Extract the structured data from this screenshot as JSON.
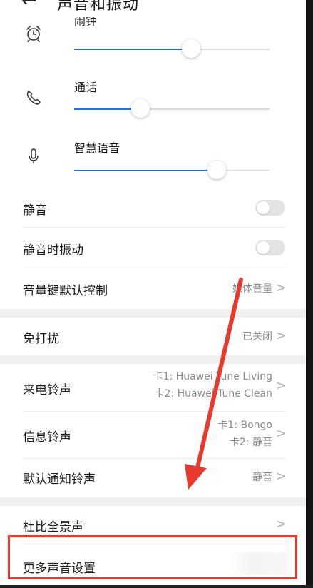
{
  "header": {
    "title": "声音和振动"
  },
  "sliders": [
    {
      "label": "闹钟",
      "icon": "alarm-clock-icon",
      "level": 0.6
    },
    {
      "label": "通话",
      "icon": "phone-icon",
      "level": 0.34
    },
    {
      "label": "智慧语音",
      "icon": "microphone-icon",
      "level": 0.73
    }
  ],
  "toggles": [
    {
      "label": "静音",
      "on": false
    },
    {
      "label": "静音时振动",
      "on": false
    }
  ],
  "volume_key": {
    "label": "音量键默认控制",
    "value": "媒体音量"
  },
  "dnd": {
    "label": "免打扰",
    "value": "已关闭"
  },
  "ringtone": {
    "label": "来电铃声",
    "value_line1": "卡1: Huawei Tune Living",
    "value_line2": "卡2: Huawei Tune Clean"
  },
  "message_tone": {
    "label": "信息铃声",
    "value_line1": "卡1: Bongo",
    "value_line2": "卡2: 静音"
  },
  "notification_tone": {
    "label": "默认通知铃声",
    "value": "静音"
  },
  "dolby": {
    "label": "杜比全景声"
  },
  "more_sound": {
    "label": "更多声音设置"
  },
  "colors": {
    "accent": "#2a6fd6",
    "annotation": "#e63a2e"
  }
}
